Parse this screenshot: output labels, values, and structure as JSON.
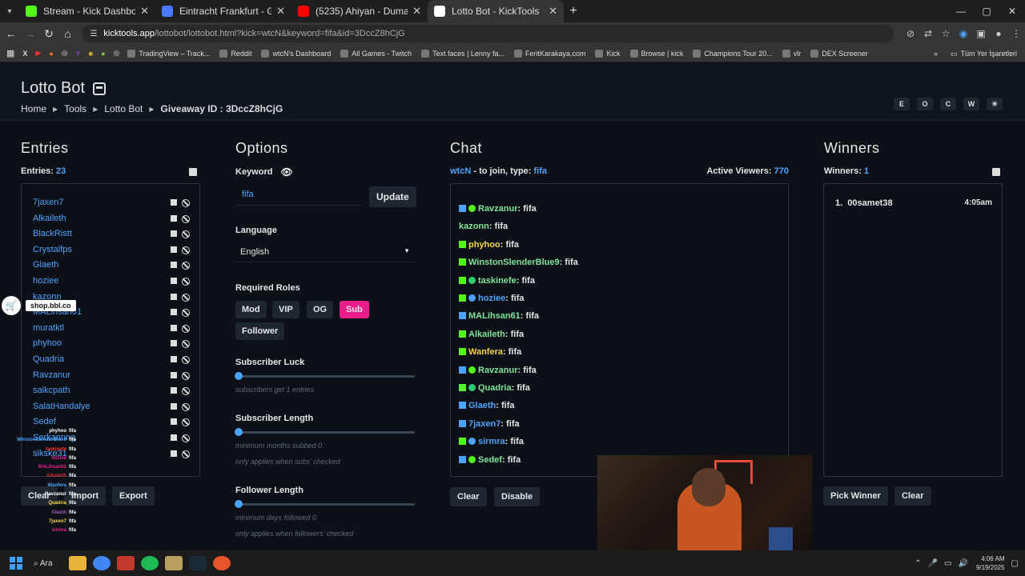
{
  "browser": {
    "tabs": [
      {
        "title": "Stream - Kick Dashboard",
        "color": "#53fc18"
      },
      {
        "title": "Eintracht Frankfurt - Galatasaray",
        "color": "#4a7aff"
      },
      {
        "title": "(5235) Ahiyan - Duman (Official",
        "color": "#ff0000"
      },
      {
        "title": "Lotto Bot - KickTools",
        "color": "#ffffff"
      }
    ],
    "url_host": "kicktools.app",
    "url_path": "/lottobot/lottobot.html?kick=wtcN&keyword=fifa&id=3DccZ8hCjG",
    "bookmarks": [
      "TradingView – Track...",
      "Reddit",
      "wtcN's Dashboard",
      "All Games - Twitch",
      "Text faces | Lenny fa...",
      "FeritKarakaya.com",
      "Kick",
      "Browse | kick",
      "Champions Tour 20...",
      "vlr",
      "DEX Screener"
    ],
    "bookmarks_all": "Tüm Yer İşaretleri"
  },
  "header": {
    "title": "Lotto Bot",
    "crumbs": [
      "Home",
      "Tools",
      "Lotto Bot"
    ],
    "giveaway_label": "Giveaway ID :",
    "giveaway_id": "3DccZ8hCjG",
    "theme_buttons": [
      "E",
      "O",
      "C",
      "W",
      "☀"
    ]
  },
  "entries": {
    "heading": "Entries",
    "count_label": "Entries:",
    "count": "23",
    "names": [
      "7jaxen7",
      "Alkaileth",
      "BlackRistt",
      "Crystalfps",
      "Glaeth",
      "hoziee",
      "kazonn",
      "MALihsan61",
      "muratktl",
      "phyhoo",
      "Quadria",
      "Ravzanur",
      "saikcpath",
      "SalatHandalye",
      "Sedef",
      "Serkannng",
      "sikske31"
    ],
    "buttons": {
      "clear": "Clear",
      "import": "Import",
      "export": "Export"
    }
  },
  "options": {
    "heading": "Options",
    "keyword_label": "Keyword",
    "keyword_value": "fifa",
    "update_label": "Update",
    "language_label": "Language",
    "language_value": "English",
    "roles_label": "Required Roles",
    "roles": [
      "Mod",
      "VIP",
      "OG",
      "Sub",
      "Follower"
    ],
    "active_role": "Sub",
    "sub_luck_label": "Subscriber Luck",
    "sub_luck_hint": "subscribers get 1 entries",
    "sub_length_label": "Subscriber Length",
    "sub_length_hint1": "minimum months subbed 0",
    "sub_length_hint2": "only applies when subs' checked",
    "follower_length_label": "Follower Length",
    "follower_length_hint1": "minimum days followed 0",
    "follower_length_hint2": "only applies when followers' checked"
  },
  "chat": {
    "heading": "Chat",
    "channel": "wtcN",
    "join_text": "- to join, type:",
    "keyword": "fifa",
    "viewers_label": "Active Viewers:",
    "viewers": "770",
    "messages": [
      {
        "user": "Ravzanur",
        "text": "fifa",
        "color": "#7fe39a",
        "badges": [
          "#4da3ff",
          "#53fc18"
        ]
      },
      {
        "user": "kazonn",
        "text": "fifa",
        "color": "#7fe39a",
        "badges": []
      },
      {
        "user": "phyhoo",
        "text": "fifa",
        "color": "#f5d34a",
        "badges": [
          "#53fc18"
        ]
      },
      {
        "user": "WinstonSlenderBlue9",
        "text": "fifa",
        "color": "#7fe39a",
        "badges": [
          "#53fc18"
        ]
      },
      {
        "user": "taskinefe",
        "text": "fifa",
        "color": "#7fe39a",
        "badges": [
          "#53fc18",
          "#2ecc71"
        ]
      },
      {
        "user": "hoziee",
        "text": "fifa",
        "color": "#4da3ff",
        "badges": [
          "#53fc18",
          "#4da3ff"
        ]
      },
      {
        "user": "MALihsan61",
        "text": "fifa",
        "color": "#7fe39a",
        "badges": [
          "#4da3ff"
        ]
      },
      {
        "user": "Alkaileth",
        "text": "fifa",
        "color": "#7fe39a",
        "badges": [
          "#53fc18"
        ]
      },
      {
        "user": "Wanfera",
        "text": "fifa",
        "color": "#f5d34a",
        "badges": [
          "#53fc18"
        ]
      },
      {
        "user": "Ravzanur",
        "text": "fifa",
        "color": "#7fe39a",
        "badges": [
          "#4da3ff",
          "#53fc18"
        ]
      },
      {
        "user": "Quadria",
        "text": "fifa",
        "color": "#7fe39a",
        "badges": [
          "#53fc18",
          "#2ecc71"
        ]
      },
      {
        "user": "Glaeth",
        "text": "fifa",
        "color": "#4da3ff",
        "badges": [
          "#4da3ff"
        ]
      },
      {
        "user": "7jaxen7",
        "text": "fifa",
        "color": "#4da3ff",
        "badges": [
          "#4da3ff"
        ]
      },
      {
        "user": "sirmra",
        "text": "fifa",
        "color": "#4da3ff",
        "badges": [
          "#53fc18",
          "#4da3ff"
        ]
      },
      {
        "user": "Sedef",
        "text": "fifa",
        "color": "#7fe39a",
        "badges": [
          "#4da3ff",
          "#53fc18"
        ]
      }
    ],
    "buttons": {
      "clear": "Clear",
      "disable": "Disable"
    }
  },
  "winners": {
    "heading": "Winners",
    "count_label": "Winners:",
    "count": "1",
    "list": [
      {
        "rank": "1.",
        "name": "00samet38",
        "time": "4:05am"
      }
    ],
    "buttons": {
      "pick": "Pick Winner",
      "clear": "Clear"
    }
  },
  "overlay": {
    "ad_text": "shop.bbl.co",
    "mini_chat": [
      "phyhoo",
      "WinstonSlenderBlue9",
      "taskinefe",
      "hoziee",
      "MALihsan61",
      "Alkaileth",
      "Wanfera",
      "Ravzanur",
      "Quadria",
      "Glaeth",
      "7jaxen7",
      "sirmra"
    ],
    "mini_chat_text": "fifa"
  },
  "taskbar": {
    "search_label": "Ara",
    "time": "4:06 AM",
    "date": "9/19/2025"
  }
}
